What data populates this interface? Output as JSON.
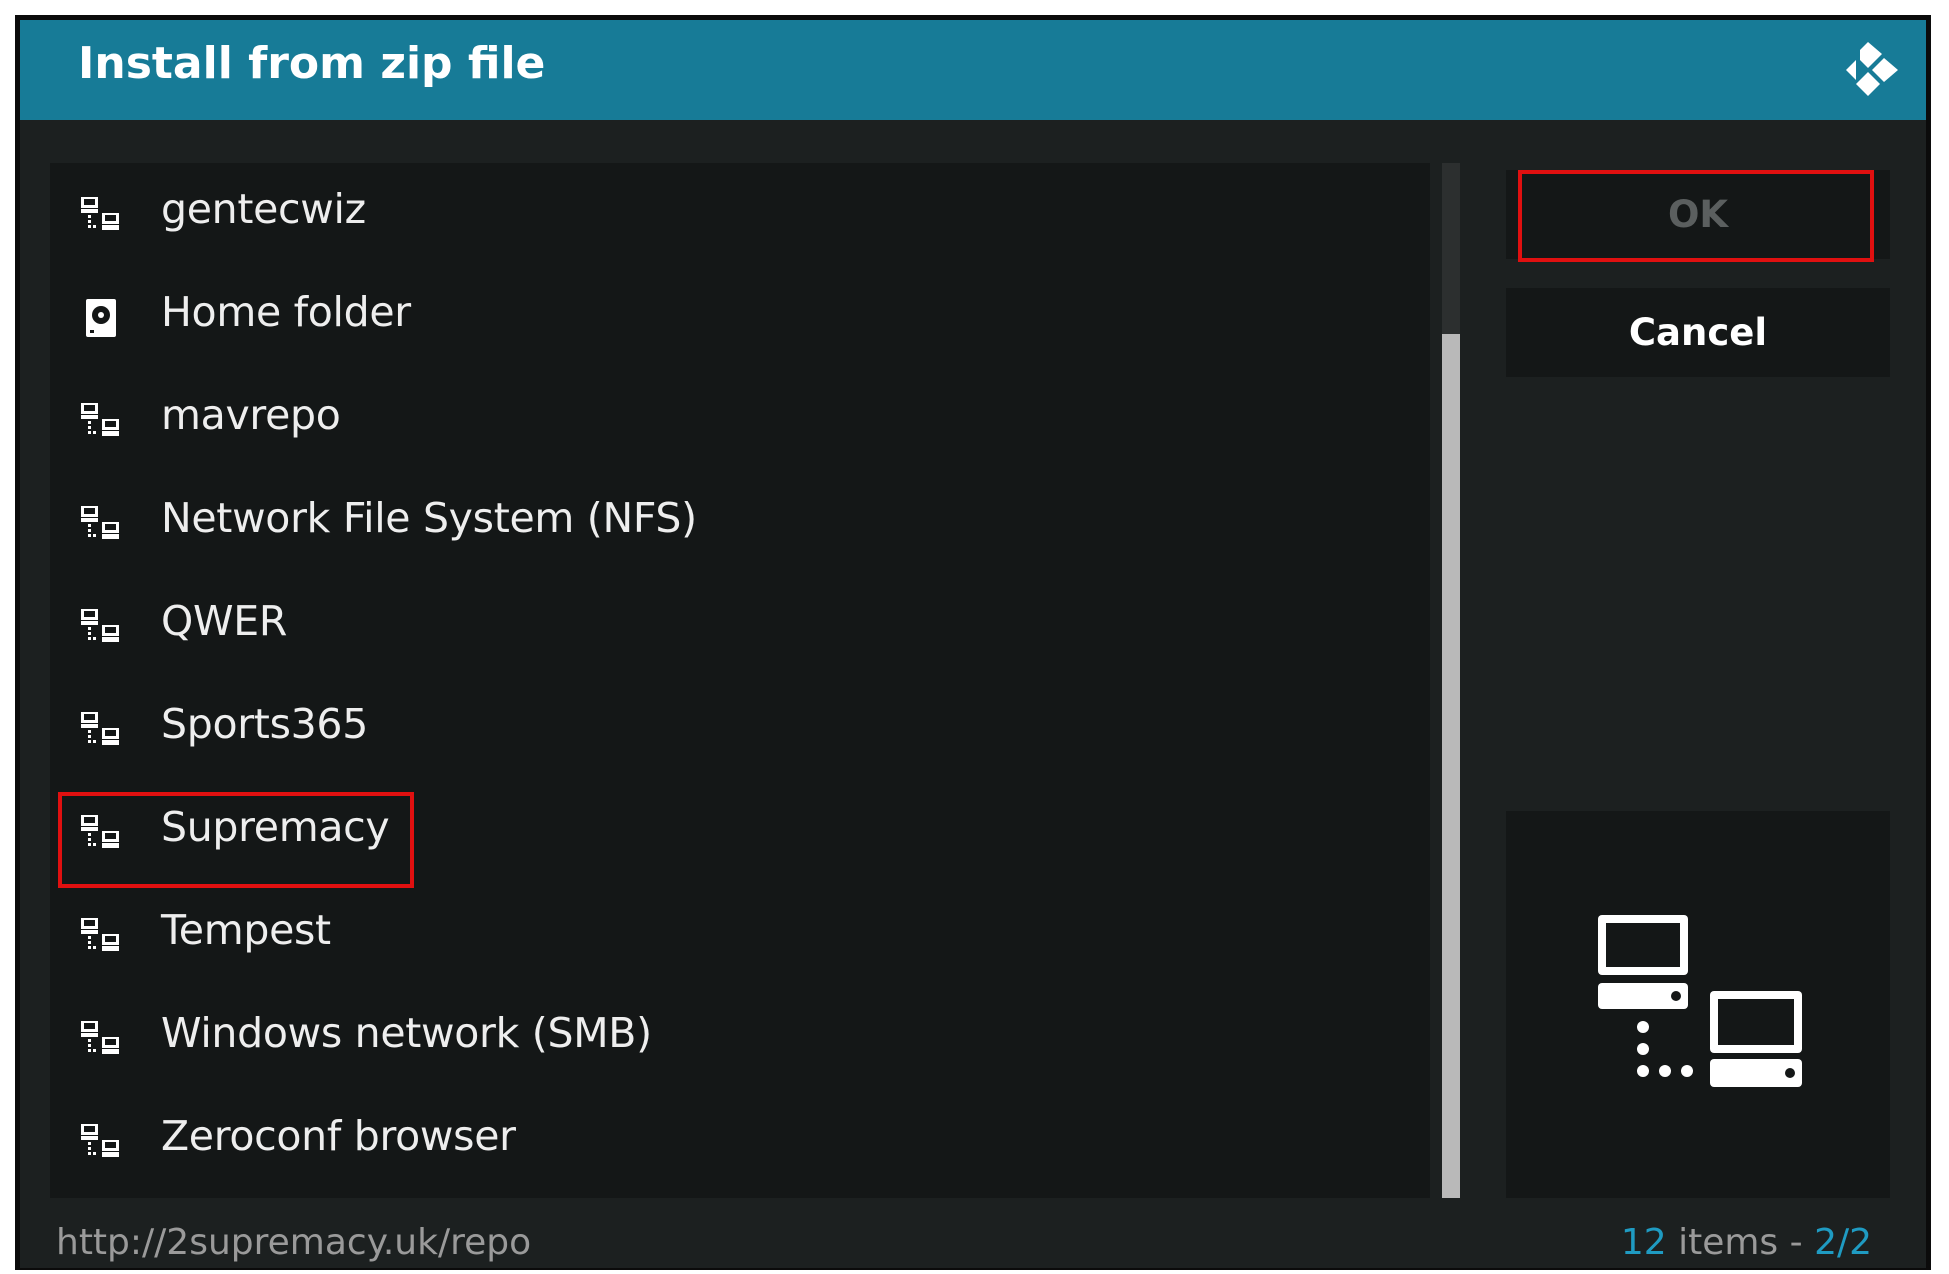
{
  "dialog": {
    "title": "Install from zip file",
    "logo_icon": "kodi-logo-icon"
  },
  "list": {
    "items": [
      {
        "label": "gentecwiz",
        "icon": "network-share-icon"
      },
      {
        "label": "Home folder",
        "icon": "hard-drive-icon"
      },
      {
        "label": "mavrepo",
        "icon": "network-share-icon"
      },
      {
        "label": "Network File System (NFS)",
        "icon": "network-share-icon"
      },
      {
        "label": "QWER",
        "icon": "network-share-icon"
      },
      {
        "label": "Sports365",
        "icon": "network-share-icon"
      },
      {
        "label": "Supremacy",
        "icon": "network-share-icon"
      },
      {
        "label": "Tempest",
        "icon": "network-share-icon"
      },
      {
        "label": "Windows network (SMB)",
        "icon": "network-share-icon"
      },
      {
        "label": "Zeroconf browser",
        "icon": "network-share-icon"
      }
    ],
    "highlighted": "Supremacy"
  },
  "buttons": {
    "ok_label": "OK",
    "cancel_label": "Cancel"
  },
  "preview": {
    "icon": "network-computers-icon"
  },
  "footer": {
    "path": "http://2supremacy.uk/repo",
    "count_number": "12",
    "count_text": " items - ",
    "page": "2/2"
  },
  "colors": {
    "header_bg": "#177b97",
    "accent": "#1f9bc2",
    "highlight_border": "#e01010"
  }
}
